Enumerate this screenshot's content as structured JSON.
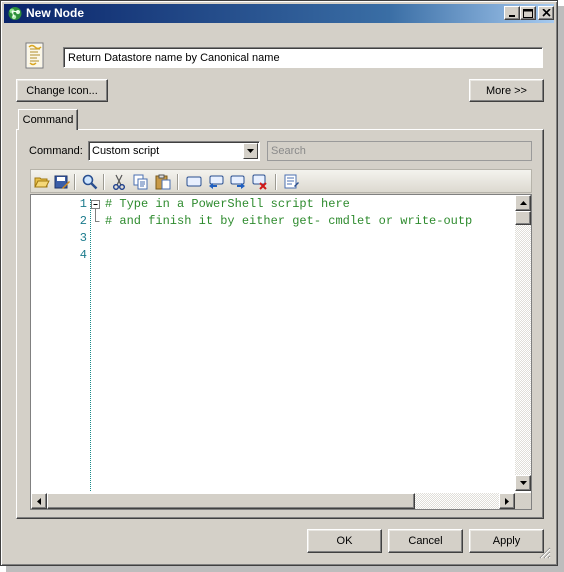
{
  "window": {
    "title": "New Node",
    "minimize_glyph": "_",
    "maximize_glyph": "□",
    "close_glyph": "×"
  },
  "node": {
    "icon": "script-scroll-icon",
    "name_value": "Return Datastore name by Canonical name"
  },
  "buttons": {
    "change_icon": "Change Icon...",
    "more": "More >>",
    "ok": "OK",
    "cancel": "Cancel",
    "apply": "Apply"
  },
  "tabs": [
    {
      "label": "Command",
      "selected": true
    }
  ],
  "command": {
    "label": "Command:",
    "selected": "Custom script",
    "search_placeholder": "Search"
  },
  "toolbar": {
    "icons": [
      "open-folder-icon",
      "save-edit-icon",
      "find-icon",
      "cut-icon",
      "copy-icon",
      "paste-icon",
      "comment-icon",
      "indent-left-icon",
      "indent-right-icon",
      "clear-icon",
      "properties-icon"
    ]
  },
  "editor": {
    "line_numbers": [
      "1",
      "2",
      "3",
      "4"
    ],
    "lines": [
      "# Type in a PowerShell script here",
      "# and finish it by either get- cmdlet or write-outp",
      "",
      ""
    ],
    "fold_marker": "⊟"
  },
  "colors": {
    "titlebar_start": "#0a246a",
    "titlebar_end": "#a6caf0",
    "face": "#d4d0c8",
    "comment_text": "#2e8b2e",
    "line_number": "#1a7a8c"
  }
}
